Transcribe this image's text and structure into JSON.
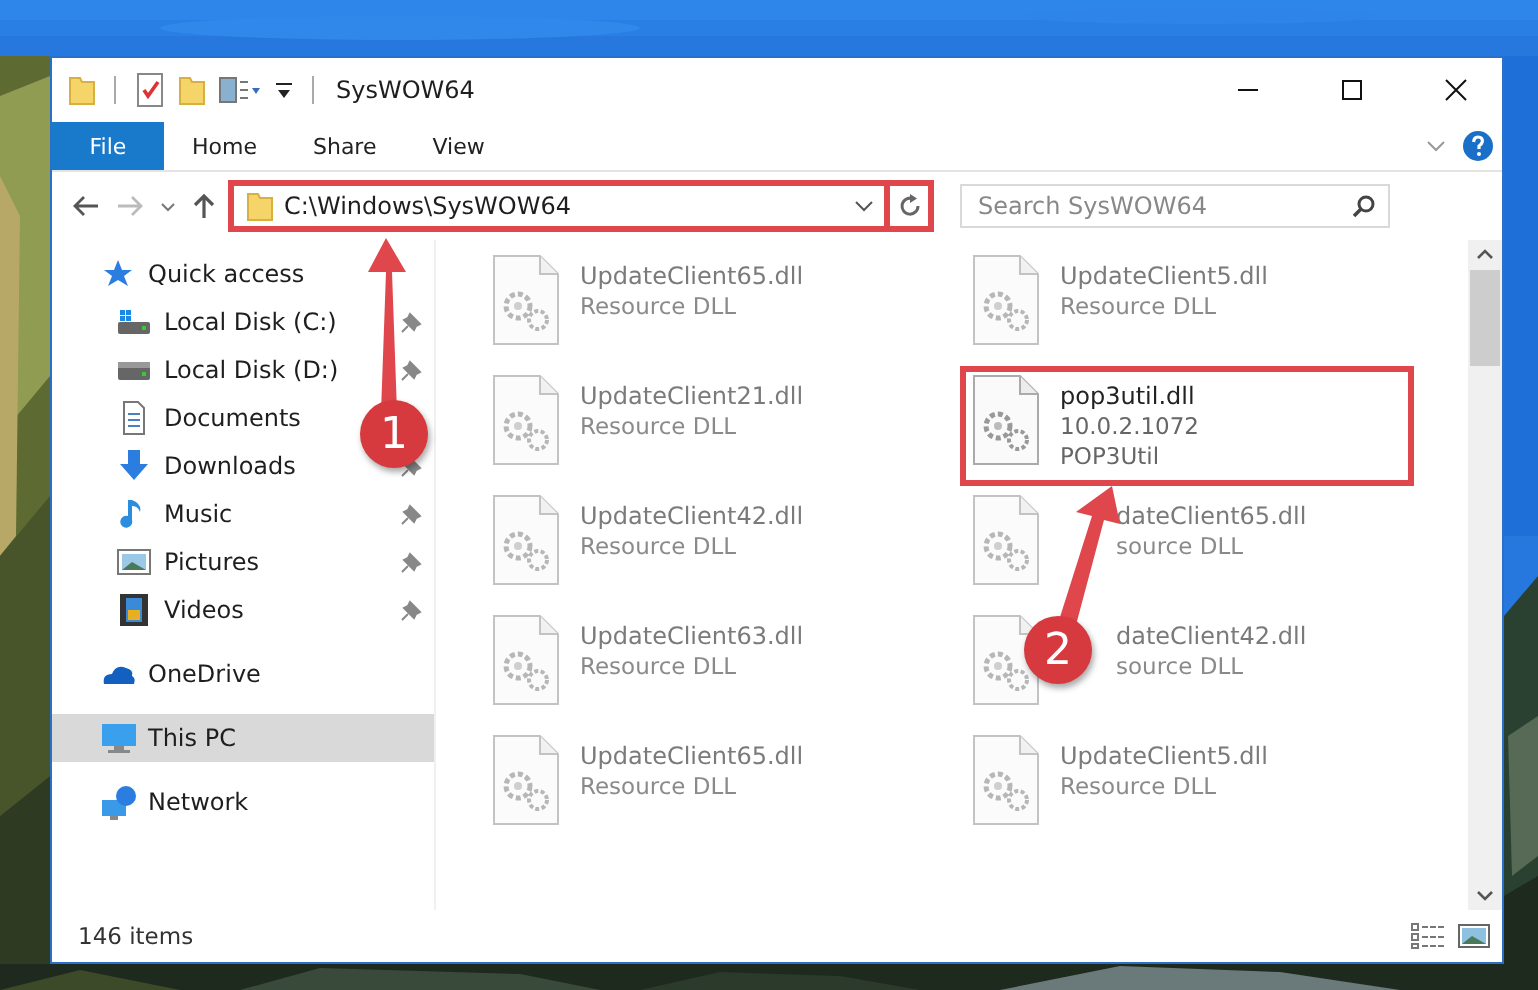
{
  "window": {
    "title": "SysWOW64"
  },
  "ribbon": {
    "tabs": [
      {
        "label": "File",
        "kind": "file"
      },
      {
        "label": "Home",
        "kind": "tab"
      },
      {
        "label": "Share",
        "kind": "tab"
      },
      {
        "label": "View",
        "kind": "tab"
      }
    ]
  },
  "address_bar": {
    "path": "C:\\Windows\\SysWOW64"
  },
  "search": {
    "placeholder": "Search SysWOW64"
  },
  "navigation": [
    {
      "label": "Quick access",
      "kind": "quick-access",
      "selected": false,
      "children": [
        {
          "label": "Local Disk (C:)",
          "kind": "drive-c",
          "pinned": true,
          "selected": false
        },
        {
          "label": "Local Disk (D:)",
          "kind": "drive",
          "pinned": true,
          "selected": false
        },
        {
          "label": "Documents",
          "kind": "documents",
          "selected": false
        },
        {
          "label": "Downloads",
          "kind": "downloads",
          "pinned": true,
          "selected": false
        },
        {
          "label": "Music",
          "kind": "music",
          "pinned": true,
          "selected": false
        },
        {
          "label": "Pictures",
          "kind": "pictures",
          "pinned": true,
          "selected": false
        },
        {
          "label": "Videos",
          "kind": "videos",
          "pinned": true,
          "selected": false
        }
      ]
    },
    {
      "label": "OneDrive",
      "kind": "onedrive",
      "selected": false
    },
    {
      "label": "This PC",
      "kind": "pc",
      "selected": true
    },
    {
      "label": "Network",
      "kind": "network",
      "selected": false
    }
  ],
  "files": [
    {
      "name": "UpdateClient65.dll",
      "details": [
        "Resource DLL"
      ],
      "highlighted": false
    },
    {
      "name": "UpdateClient5.dll",
      "details": [
        "Resource DLL"
      ],
      "highlighted": false
    },
    {
      "name": "UpdateClient21.dll",
      "details": [
        "Resource DLL"
      ],
      "highlighted": false
    },
    {
      "name": "pop3util.dll",
      "details": [
        "10.0.2.1072",
        "POP3Util"
      ],
      "highlighted": true
    },
    {
      "name": "UpdateClient42.dll",
      "details": [
        "Resource DLL"
      ],
      "highlighted": false
    },
    {
      "name": "dateClient65.dll",
      "details": [
        "source DLL"
      ],
      "highlighted": false
    },
    {
      "name": "UpdateClient63.dll",
      "details": [
        "Resource DLL"
      ],
      "highlighted": false
    },
    {
      "name": "dateClient42.dll",
      "details": [
        "source DLL"
      ],
      "highlighted": false
    },
    {
      "name": "UpdateClient65.dll",
      "details": [
        "Resource DLL"
      ],
      "highlighted": false
    },
    {
      "name": "UpdateClient5.dll",
      "details": [
        "Resource DLL"
      ],
      "highlighted": false
    }
  ],
  "status_bar": {
    "item_count": "146 items"
  },
  "annotations": [
    {
      "number": "1"
    },
    {
      "number": "2"
    }
  ]
}
